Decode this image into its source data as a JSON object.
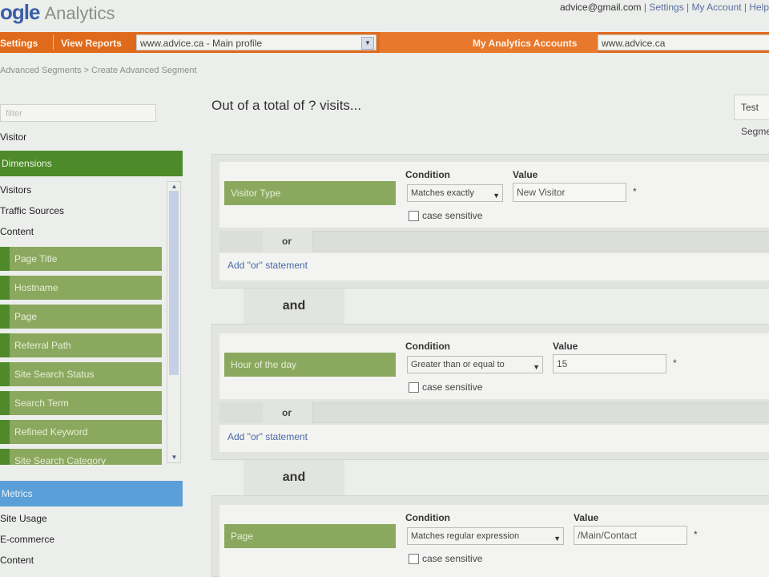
{
  "app": {
    "logo_prefix": "ogle",
    "logo_name": "Analytics",
    "user_email": "advice@gmail.com",
    "user_links": "| Settings | My Account | Help"
  },
  "nav": {
    "settings": "Settings",
    "view_reports": "View Reports",
    "profile_select": "www.advice.ca - Main profile",
    "my_accounts": "My Analytics Accounts",
    "account_select": "www.advice.ca"
  },
  "breadcrumb": "Advanced Segments > Create Advanced Segment",
  "sidebar": {
    "search_placeholder": "filter",
    "top_item": "Visitor",
    "dimensions_header": "Dimensions",
    "dimension_groups": [
      "Visitors",
      "Traffic Sources",
      "Content"
    ],
    "green_items": [
      "Page Title",
      "Hostname",
      "Page",
      "Referral Path",
      "Site Search Status",
      "Search Term",
      "Refined Keyword",
      "Site Search Category"
    ],
    "metrics_header": "Metrics",
    "metric_groups": [
      "Site Usage",
      "E-commerce",
      "Content"
    ]
  },
  "main": {
    "title": "Out of a total of ? visits...",
    "test_button": "Test Segment",
    "condition_label": "Condition",
    "value_label": "Value",
    "case_sensitive_label": "case sensitive",
    "or_label": "or",
    "add_or_label": "Add \"or\" statement",
    "and_label": "and",
    "required_mark": "*",
    "conditions": [
      {
        "dimension": "Visitor Type",
        "condition": "Matches exactly",
        "value": "New Visitor"
      },
      {
        "dimension": "Hour of the day",
        "condition": "Greater than or equal to",
        "value": "15"
      },
      {
        "dimension": "Page",
        "condition": "Matches regular expression",
        "value": "/Main/Contact"
      }
    ]
  },
  "colors": {
    "orange_bar": "#e06a1c",
    "dimension_green": "#4e8a2a",
    "item_green": "#8ba85f",
    "metric_blue": "#5b9fd8"
  }
}
